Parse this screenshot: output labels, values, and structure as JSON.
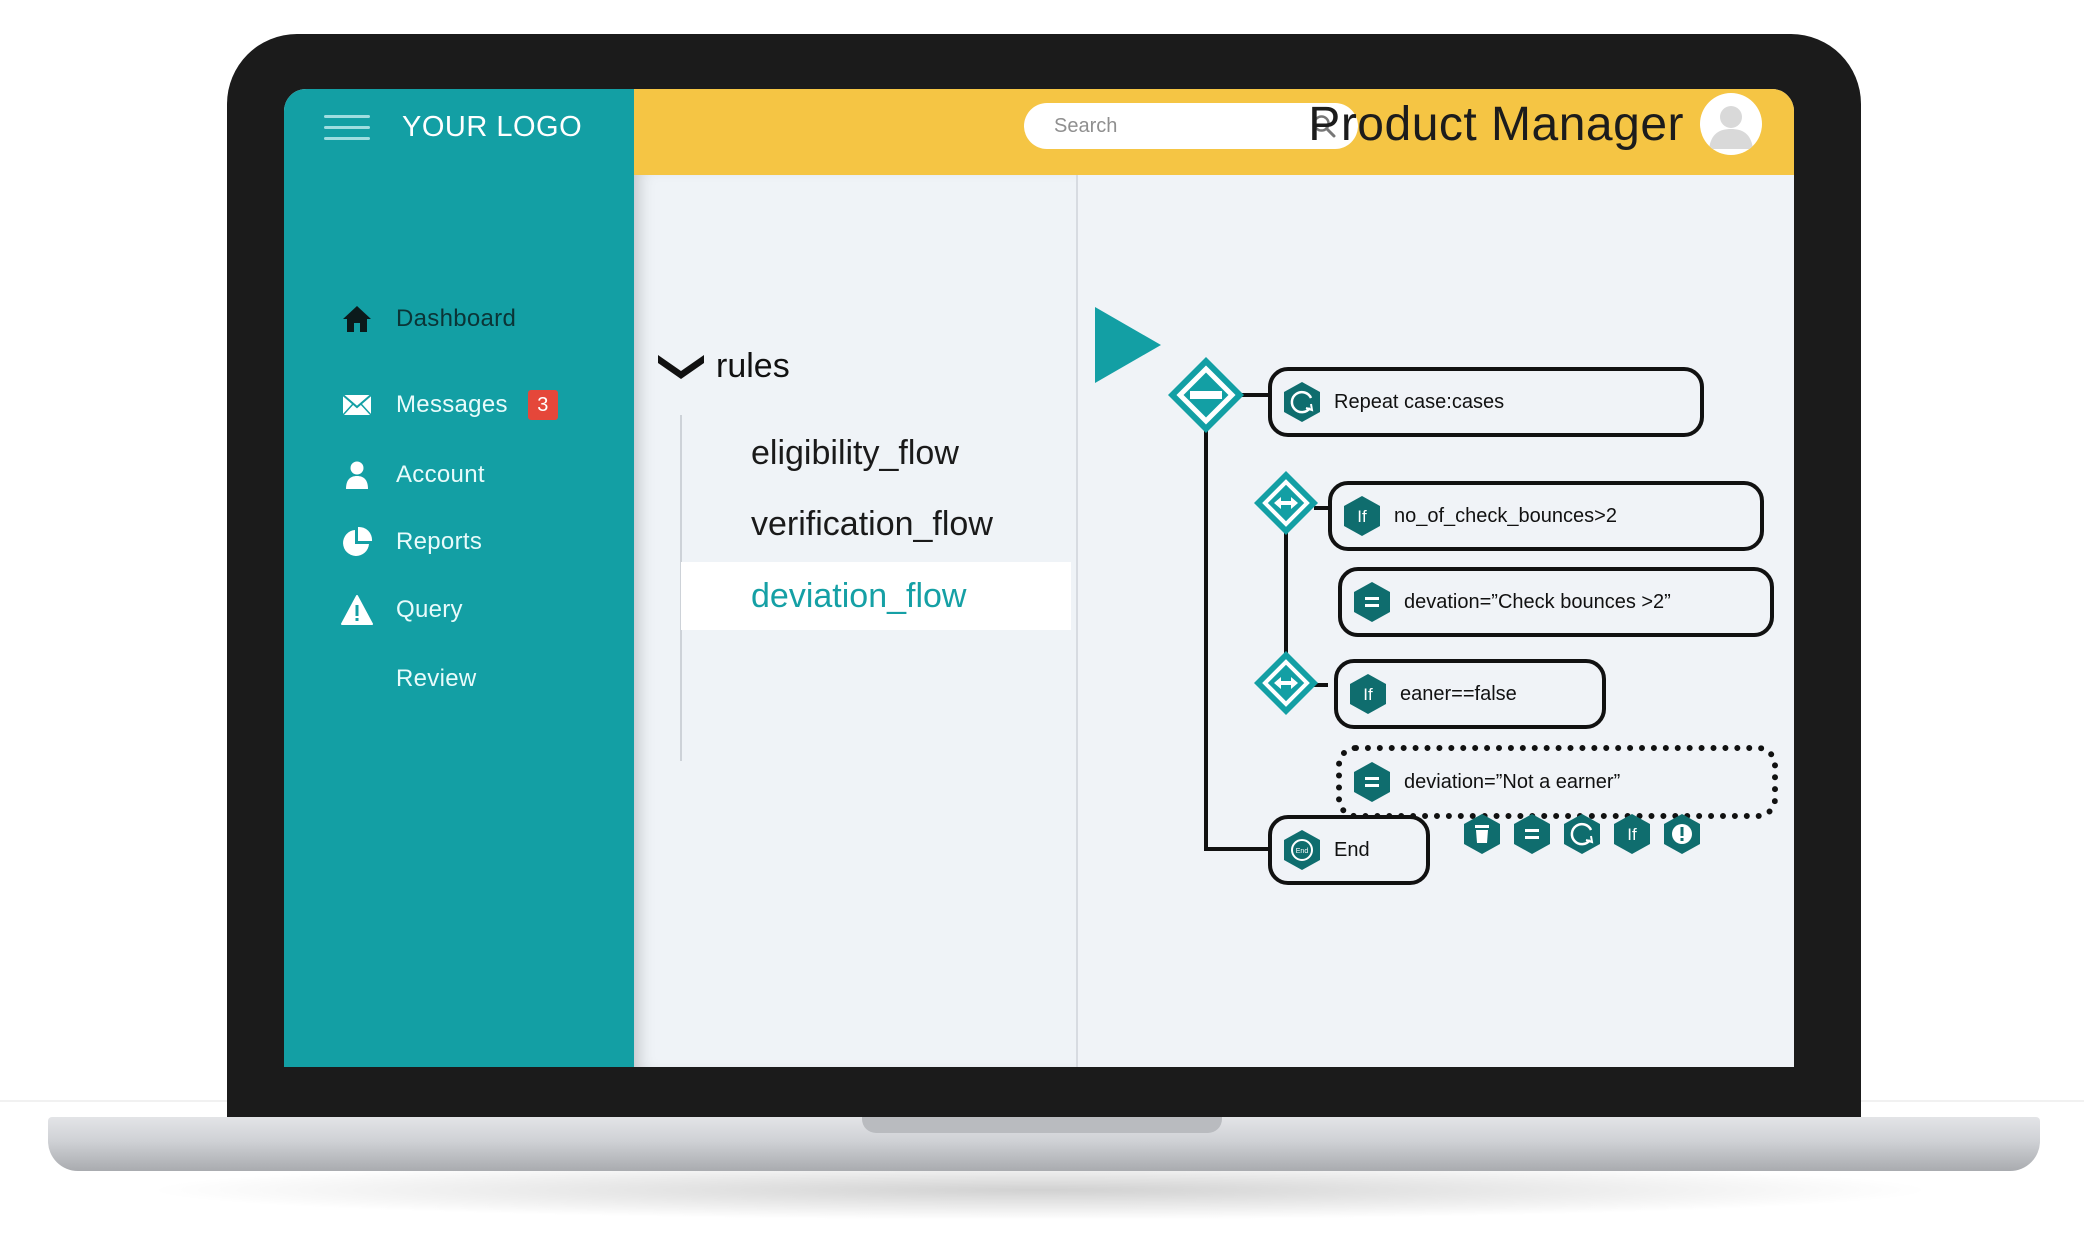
{
  "app": {
    "logo_text": "YOUR LOGO",
    "page_title": "Product Manager",
    "colors": {
      "sidebar": "#139fa4",
      "topbar": "#f5c544",
      "accent": "#15a0a5",
      "badge": "#e5473a",
      "node_icon": "#0f6d6e"
    }
  },
  "search": {
    "placeholder": "Search",
    "value": ""
  },
  "sidebar": {
    "items": [
      {
        "label": "Dashboard",
        "icon": "home-icon",
        "active": true
      },
      {
        "label": "Messages",
        "icon": "envelope-icon",
        "badge": "3"
      },
      {
        "label": "Account",
        "icon": "user-icon"
      },
      {
        "label": "Reports",
        "icon": "pie-chart-icon"
      },
      {
        "label": "Query",
        "icon": "warning-icon"
      },
      {
        "label": "Review",
        "icon": ""
      }
    ]
  },
  "rules": {
    "root_label": "rules",
    "flows": [
      {
        "label": "eligibility_flow"
      },
      {
        "label": "verification_flow"
      },
      {
        "label": "deviation_flow",
        "selected": true
      }
    ]
  },
  "flow": {
    "run_icon": "play-icon",
    "nodes": [
      {
        "text": "Repeat case:cases",
        "icon": "loop-icon"
      },
      {
        "text": "no_of_check_bounces>2",
        "icon": "if-icon",
        "icon_text": "If"
      },
      {
        "text": "devation=”Check bounces >2”",
        "icon": "assign-icon"
      },
      {
        "text": "eaner==false",
        "icon": "if-icon",
        "icon_text": "If"
      },
      {
        "text": "deviation=”Not a earner”",
        "icon": "assign-icon"
      },
      {
        "text": "End",
        "icon": "end-icon",
        "icon_text": "End"
      }
    ],
    "toolbar": [
      {
        "icon": "trash-icon"
      },
      {
        "icon": "assign-icon"
      },
      {
        "icon": "loop-icon"
      },
      {
        "icon": "if-icon",
        "icon_text": "If"
      },
      {
        "icon": "alert-icon"
      }
    ]
  }
}
